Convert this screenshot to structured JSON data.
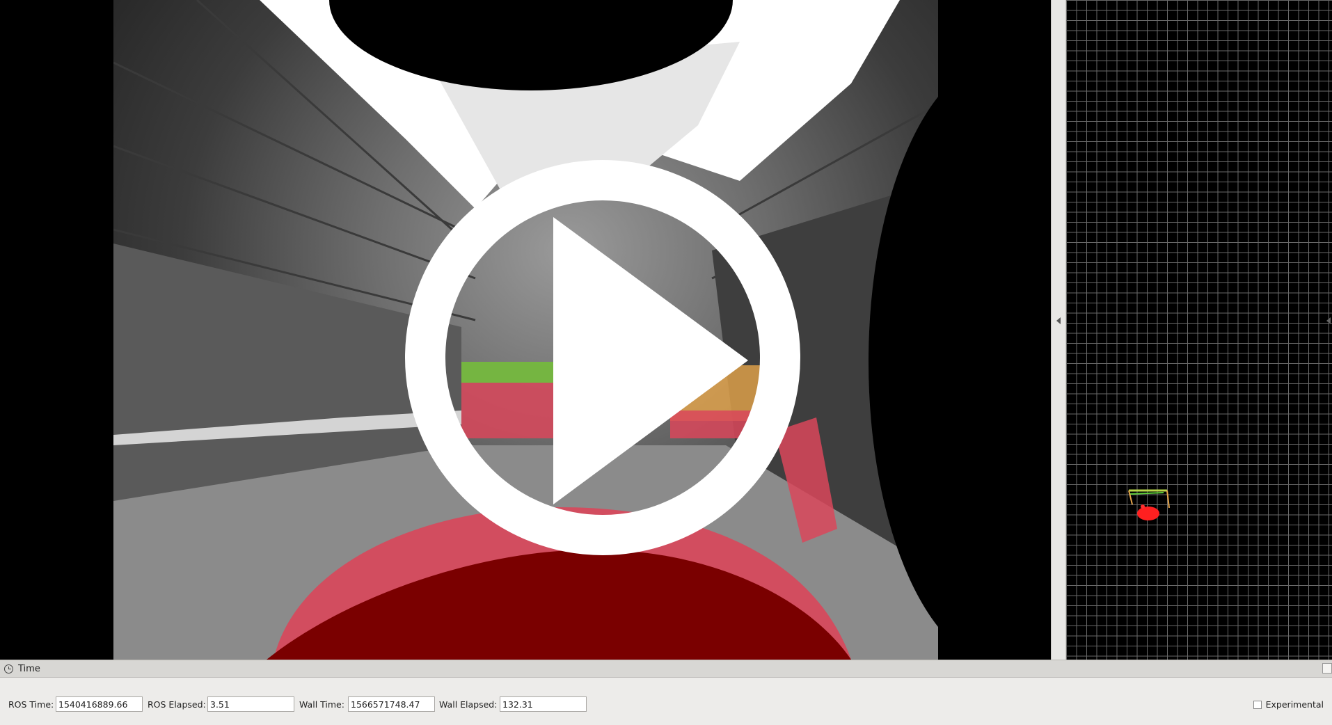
{
  "camera_view": {
    "overlay_icon": "play-button-icon"
  },
  "grid_view": {
    "grid_visible": true
  },
  "time_panel": {
    "title": "Time",
    "icon": "clock-icon",
    "ros_time_label": "ROS Time:",
    "ros_time_value": "1540416889.66",
    "ros_elapsed_label": "ROS Elapsed:",
    "ros_elapsed_value": "3.51",
    "wall_time_label": "Wall Time:",
    "wall_time_value": "1566571748.47",
    "wall_elapsed_label": "Wall Elapsed:",
    "wall_elapsed_value": "132.31",
    "experimental_label": "Experimental",
    "experimental_checked": false
  },
  "colors": {
    "pointcloud_red": "#d9465a",
    "robot_mask": "#7a0000",
    "pointcloud_green": "#5fcf3a"
  }
}
